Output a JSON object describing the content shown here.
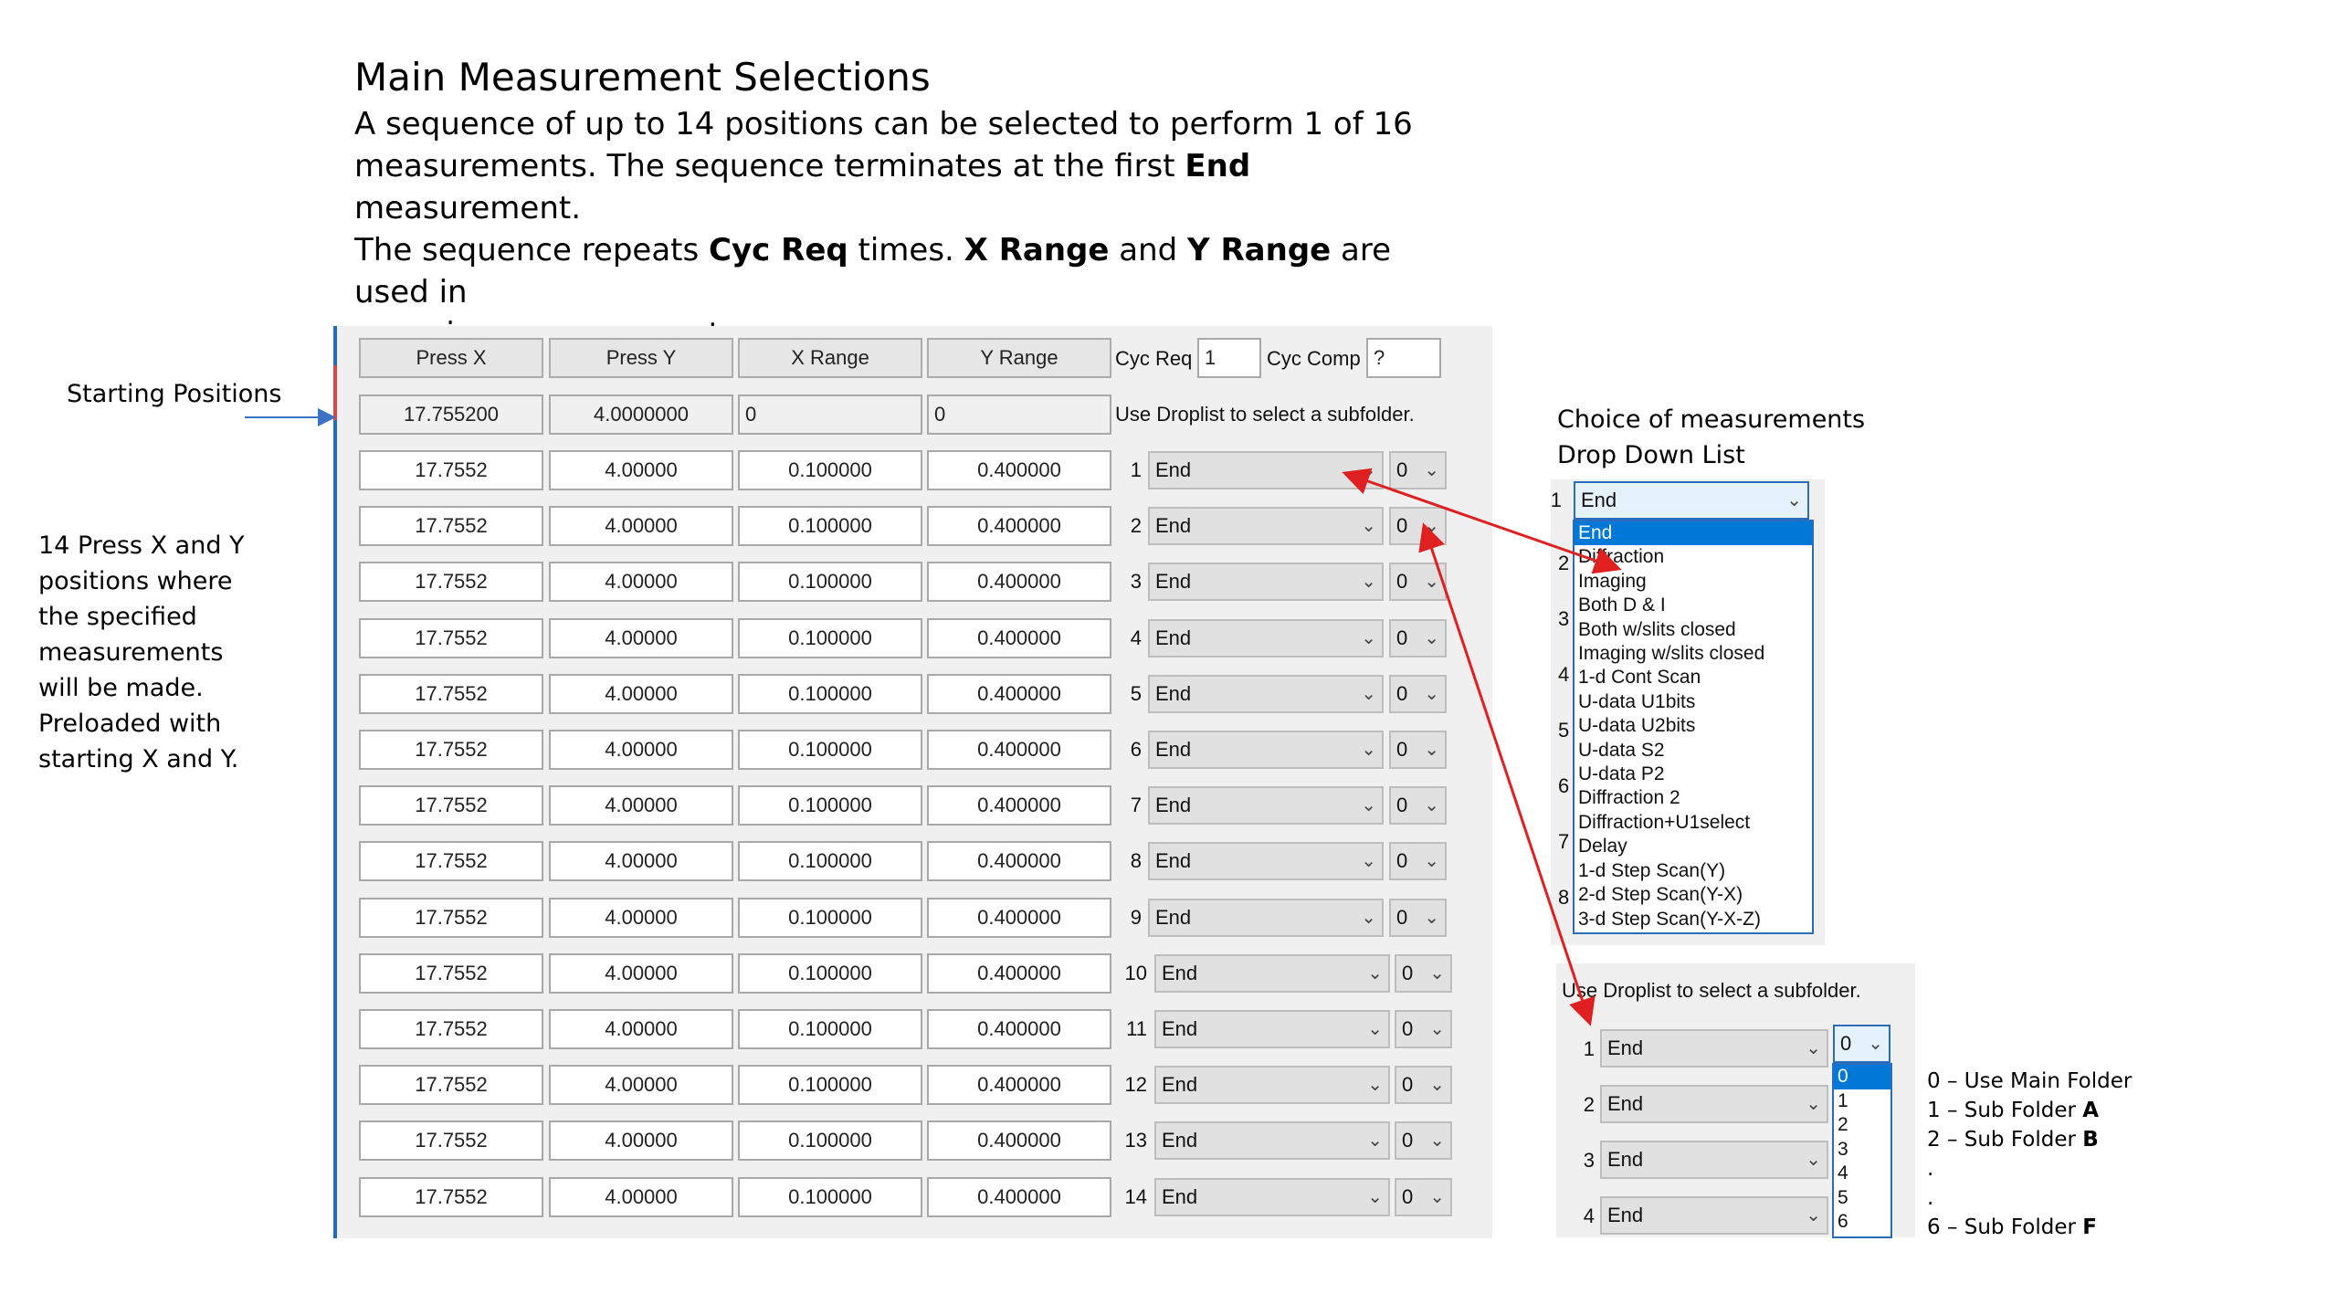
{
  "title": "Main Measurement Selections",
  "description": {
    "l1": "A sequence of up to 14 positions can be selected to perform 1 of 16",
    "l2a": "measurements. The sequence terminates at the first ",
    "l2b": "End",
    "l2c": " measurement.",
    "l3a": "The sequence repeats ",
    "l3b": "Cyc Req",
    "l3c": " times. ",
    "l3d": "X Range",
    "l3e": " and ",
    "l3f": "Y Range",
    "l3g": " are used in",
    "l4": "scanning measurements."
  },
  "side_labels": {
    "starting": "Starting Positions",
    "press_lines": [
      "14 Press X and Y",
      "positions where",
      "the specified",
      "measurements",
      "will be made.",
      "Preloaded with",
      "starting X and Y."
    ],
    "choice_l1": "Choice of measurements",
    "choice_l2": "Drop Down List"
  },
  "headers": {
    "press_x": "Press X",
    "press_y": "Press Y",
    "x_range": "X Range",
    "y_range": "Y Range",
    "cyc_req_label": "Cyc Req",
    "cyc_req_value": "1",
    "cyc_comp_label": "Cyc Comp",
    "cyc_comp_value": "?"
  },
  "start_row": {
    "x": "17.755200",
    "y": "4.0000000",
    "xr": "0",
    "yr": "0",
    "hint": "Use Droplist to select a subfolder."
  },
  "rows": [
    {
      "i": "1",
      "x": "17.7552",
      "y": "4.00000",
      "xr": "0.100000",
      "yr": "0.400000",
      "m": "End",
      "f": "0"
    },
    {
      "i": "2",
      "x": "17.7552",
      "y": "4.00000",
      "xr": "0.100000",
      "yr": "0.400000",
      "m": "End",
      "f": "0"
    },
    {
      "i": "3",
      "x": "17.7552",
      "y": "4.00000",
      "xr": "0.100000",
      "yr": "0.400000",
      "m": "End",
      "f": "0"
    },
    {
      "i": "4",
      "x": "17.7552",
      "y": "4.00000",
      "xr": "0.100000",
      "yr": "0.400000",
      "m": "End",
      "f": "0"
    },
    {
      "i": "5",
      "x": "17.7552",
      "y": "4.00000",
      "xr": "0.100000",
      "yr": "0.400000",
      "m": "End",
      "f": "0"
    },
    {
      "i": "6",
      "x": "17.7552",
      "y": "4.00000",
      "xr": "0.100000",
      "yr": "0.400000",
      "m": "End",
      "f": "0"
    },
    {
      "i": "7",
      "x": "17.7552",
      "y": "4.00000",
      "xr": "0.100000",
      "yr": "0.400000",
      "m": "End",
      "f": "0"
    },
    {
      "i": "8",
      "x": "17.7552",
      "y": "4.00000",
      "xr": "0.100000",
      "yr": "0.400000",
      "m": "End",
      "f": "0"
    },
    {
      "i": "9",
      "x": "17.7552",
      "y": "4.00000",
      "xr": "0.100000",
      "yr": "0.400000",
      "m": "End",
      "f": "0"
    },
    {
      "i": "10",
      "x": "17.7552",
      "y": "4.00000",
      "xr": "0.100000",
      "yr": "0.400000",
      "m": "End",
      "f": "0"
    },
    {
      "i": "11",
      "x": "17.7552",
      "y": "4.00000",
      "xr": "0.100000",
      "yr": "0.400000",
      "m": "End",
      "f": "0"
    },
    {
      "i": "12",
      "x": "17.7552",
      "y": "4.00000",
      "xr": "0.100000",
      "yr": "0.400000",
      "m": "End",
      "f": "0"
    },
    {
      "i": "13",
      "x": "17.7552",
      "y": "4.00000",
      "xr": "0.100000",
      "yr": "0.400000",
      "m": "End",
      "f": "0"
    },
    {
      "i": "14",
      "x": "17.7552",
      "y": "4.00000",
      "xr": "0.100000",
      "yr": "0.400000",
      "m": "End",
      "f": "0"
    }
  ],
  "measurement_dropdown": {
    "index": "1",
    "selected": "End",
    "side_numbers": [
      "2",
      "3",
      "4",
      "5",
      "6",
      "7",
      "8"
    ],
    "options": [
      "End",
      "Diffraction",
      "Imaging",
      "Both D & I",
      "Both w/slits closed",
      "Imaging w/slits closed",
      "1-d Cont Scan",
      "U-data U1bits",
      "U-data U2bits",
      "U-data S2",
      "U-data P2",
      "Diffraction 2",
      "Diffraction+U1select",
      "Delay",
      "1-d Step Scan(Y)",
      "2-d Step Scan(Y-X)",
      "3-d Step Scan(Y-X-Z)"
    ]
  },
  "subfolder_panel": {
    "hint": "Use Droplist to select a subfolder.",
    "rows": [
      {
        "i": "1",
        "m": "End",
        "f": "0"
      },
      {
        "i": "2",
        "m": "End"
      },
      {
        "i": "3",
        "m": "End"
      },
      {
        "i": "4",
        "m": "End"
      }
    ],
    "options": [
      "0",
      "1",
      "2",
      "3",
      "4",
      "5",
      "6"
    ]
  },
  "folder_notes": {
    "n0": "0 – Use Main Folder",
    "n1a": "1 – Sub Folder ",
    "n1b": "A",
    "n2a": "2 – Sub Folder ",
    "n2b": "B",
    "dot1": ".",
    "dot2": ".",
    "n6a": "6 – Sub Folder ",
    "n6b": "F"
  },
  "colors": {
    "arrow": "#e02020",
    "highlight": "#0078d7",
    "panel_bg": "#f0f0f0"
  }
}
